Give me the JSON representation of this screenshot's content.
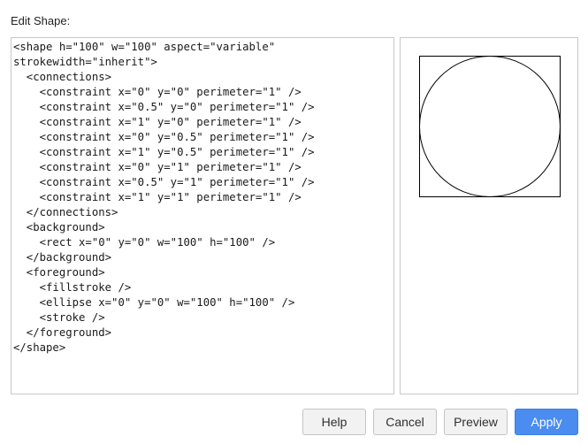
{
  "dialog": {
    "title": "Edit Shape:"
  },
  "editor": {
    "content": "<shape h=\"100\" w=\"100\" aspect=\"variable\"\nstrokewidth=\"inherit\">\n  <connections>\n    <constraint x=\"0\" y=\"0\" perimeter=\"1\" />\n    <constraint x=\"0.5\" y=\"0\" perimeter=\"1\" />\n    <constraint x=\"1\" y=\"0\" perimeter=\"1\" />\n    <constraint x=\"0\" y=\"0.5\" perimeter=\"1\" />\n    <constraint x=\"1\" y=\"0.5\" perimeter=\"1\" />\n    <constraint x=\"0\" y=\"1\" perimeter=\"1\" />\n    <constraint x=\"0.5\" y=\"1\" perimeter=\"1\" />\n    <constraint x=\"1\" y=\"1\" perimeter=\"1\" />\n  </connections>\n  <background>\n    <rect x=\"0\" y=\"0\" w=\"100\" h=\"100\" />\n  </background>\n  <foreground>\n    <fillstroke />\n    <ellipse x=\"0\" y=\"0\" w=\"100\" h=\"100\" />\n    <stroke />\n  </foreground>\n</shape>"
  },
  "buttons": {
    "help": "Help",
    "cancel": "Cancel",
    "preview": "Preview",
    "apply": "Apply"
  },
  "colors": {
    "apply_bg": "#4a8cf0",
    "border": "#c8c8c8"
  }
}
